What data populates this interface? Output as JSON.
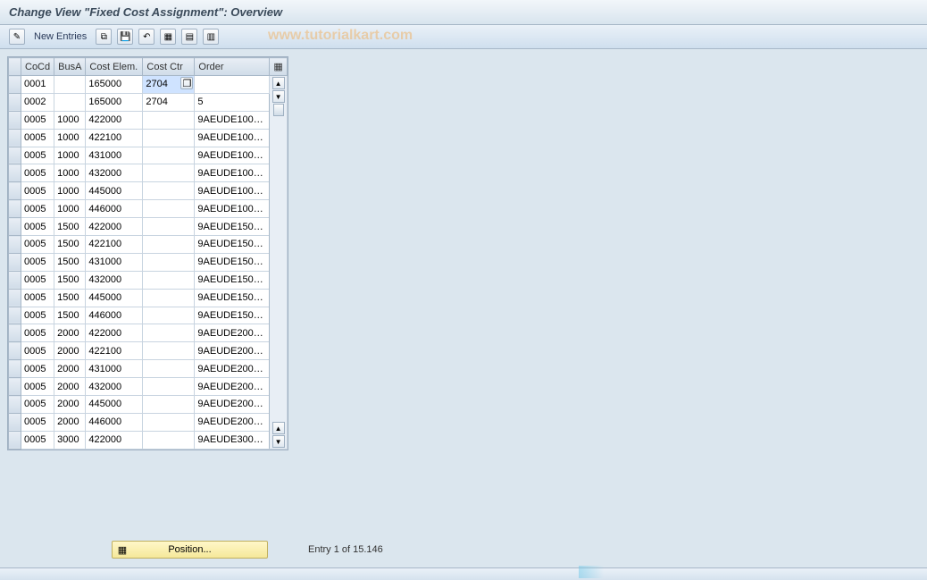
{
  "title": "Change View \"Fixed Cost Assignment\": Overview",
  "toolbar": {
    "new_entries": "New Entries",
    "watermark": "www.tutorialkart.com"
  },
  "columns": {
    "cocd": "CoCd",
    "busa": "BusA",
    "cost_elem": "Cost Elem.",
    "cost_ctr": "Cost Ctr",
    "order": "Order"
  },
  "rows": [
    {
      "cocd": "0001",
      "busa": "",
      "elem": "165000",
      "ctr": "2704",
      "order": "",
      "selected": true
    },
    {
      "cocd": "0002",
      "busa": "",
      "elem": "165000",
      "ctr": "2704",
      "order": "5"
    },
    {
      "cocd": "0005",
      "busa": "1000",
      "elem": "422000",
      "ctr": "",
      "order": "9AEUDE100…"
    },
    {
      "cocd": "0005",
      "busa": "1000",
      "elem": "422100",
      "ctr": "",
      "order": "9AEUDE100…"
    },
    {
      "cocd": "0005",
      "busa": "1000",
      "elem": "431000",
      "ctr": "",
      "order": "9AEUDE100…"
    },
    {
      "cocd": "0005",
      "busa": "1000",
      "elem": "432000",
      "ctr": "",
      "order": "9AEUDE100…"
    },
    {
      "cocd": "0005",
      "busa": "1000",
      "elem": "445000",
      "ctr": "",
      "order": "9AEUDE100…"
    },
    {
      "cocd": "0005",
      "busa": "1000",
      "elem": "446000",
      "ctr": "",
      "order": "9AEUDE100…"
    },
    {
      "cocd": "0005",
      "busa": "1500",
      "elem": "422000",
      "ctr": "",
      "order": "9AEUDE150…"
    },
    {
      "cocd": "0005",
      "busa": "1500",
      "elem": "422100",
      "ctr": "",
      "order": "9AEUDE150…"
    },
    {
      "cocd": "0005",
      "busa": "1500",
      "elem": "431000",
      "ctr": "",
      "order": "9AEUDE150…"
    },
    {
      "cocd": "0005",
      "busa": "1500",
      "elem": "432000",
      "ctr": "",
      "order": "9AEUDE150…"
    },
    {
      "cocd": "0005",
      "busa": "1500",
      "elem": "445000",
      "ctr": "",
      "order": "9AEUDE150…"
    },
    {
      "cocd": "0005",
      "busa": "1500",
      "elem": "446000",
      "ctr": "",
      "order": "9AEUDE150…"
    },
    {
      "cocd": "0005",
      "busa": "2000",
      "elem": "422000",
      "ctr": "",
      "order": "9AEUDE200…"
    },
    {
      "cocd": "0005",
      "busa": "2000",
      "elem": "422100",
      "ctr": "",
      "order": "9AEUDE200…"
    },
    {
      "cocd": "0005",
      "busa": "2000",
      "elem": "431000",
      "ctr": "",
      "order": "9AEUDE200…"
    },
    {
      "cocd": "0005",
      "busa": "2000",
      "elem": "432000",
      "ctr": "",
      "order": "9AEUDE200…"
    },
    {
      "cocd": "0005",
      "busa": "2000",
      "elem": "445000",
      "ctr": "",
      "order": "9AEUDE200…"
    },
    {
      "cocd": "0005",
      "busa": "2000",
      "elem": "446000",
      "ctr": "",
      "order": "9AEUDE200…"
    },
    {
      "cocd": "0005",
      "busa": "3000",
      "elem": "422000",
      "ctr": "",
      "order": "9AEUDE300…"
    }
  ],
  "footer": {
    "position_label": "Position...",
    "entry_info": "Entry 1 of 15.146"
  },
  "icons": {
    "pencil": "✎",
    "copy": "⧉",
    "save": "💾",
    "undo": "↶",
    "select_all": "▦",
    "page": "▤",
    "delete": "▥",
    "config": "▦",
    "f4": "❐",
    "up": "▲",
    "down": "▼",
    "pos": "▦"
  }
}
